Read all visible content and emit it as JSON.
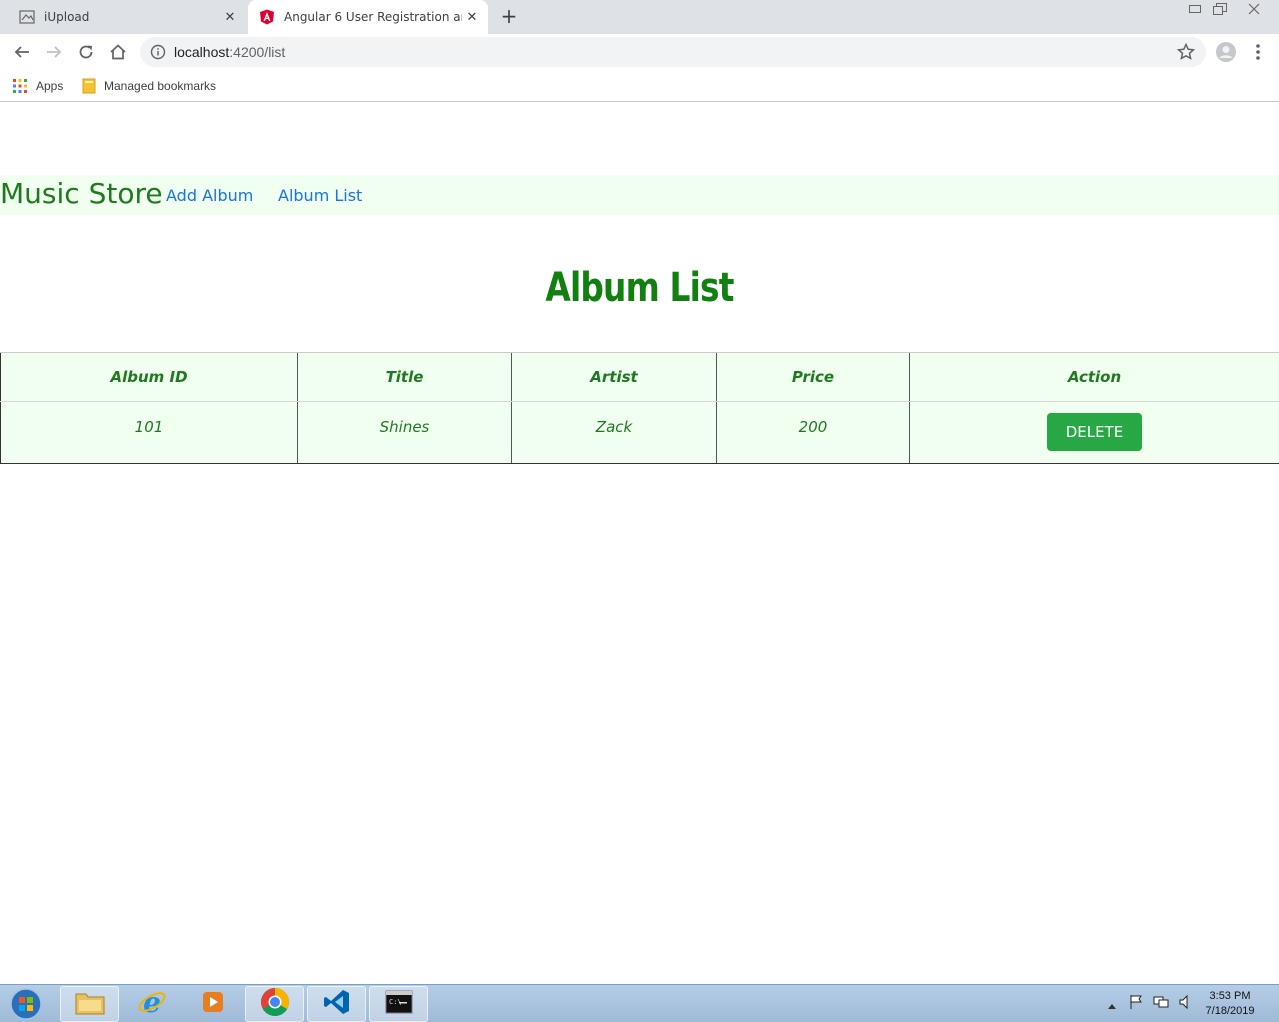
{
  "browser": {
    "tabs": [
      {
        "title": "iUpload",
        "icon": "upload-page-icon",
        "active": false
      },
      {
        "title": "Angular 6 User Registration and L",
        "icon": "angular-icon",
        "active": true
      }
    ],
    "url_host": "localhost",
    "url_path": ":4200/list",
    "bookmarks": [
      {
        "label": "Apps",
        "icon": "apps-grid-icon"
      },
      {
        "label": "Managed bookmarks",
        "icon": "folder-icon"
      }
    ]
  },
  "app": {
    "brand": "Music Store",
    "nav": [
      {
        "label": "Add Album"
      },
      {
        "label": "Album List"
      }
    ],
    "page_title": "Album List",
    "table": {
      "columns": [
        "Album ID",
        "Title",
        "Artist",
        "Price",
        "Action"
      ],
      "rows": [
        {
          "id": "101",
          "title": "Shines",
          "artist": "Zack",
          "price": "200",
          "action_label": "DELETE"
        }
      ]
    }
  },
  "taskbar": {
    "time": "3:53 PM",
    "date": "7/18/2019"
  },
  "colors": {
    "brand_green": "#1f7a1f",
    "nav_bg": "#f0fff0",
    "delete_button": "#28a745",
    "link_blue": "#1a73e8"
  }
}
